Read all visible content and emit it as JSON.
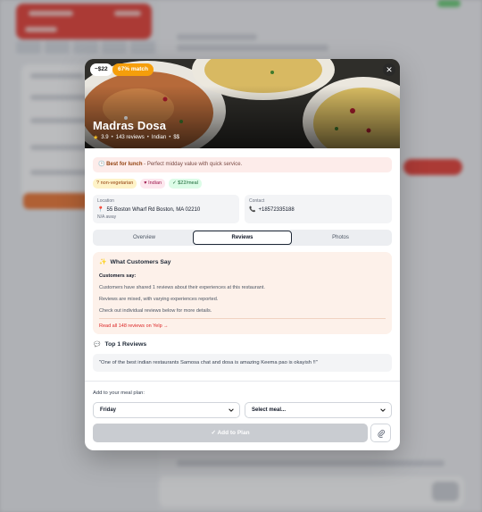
{
  "modal": {
    "price_badge": "~$22",
    "match_badge": "67% match",
    "close_glyph": "✕",
    "restaurant_name": "Madras Dosa",
    "rating": "3.9",
    "review_count": "143 reviews",
    "cuisine": "Indian",
    "price_level": "$$",
    "banner": {
      "title": "Best for lunch",
      "text": " - Perfect midday value with quick service."
    },
    "tags": [
      "non-vegetarian",
      "Indian",
      "$22/meal"
    ],
    "tag_icons": [
      "?",
      "♥",
      "✓"
    ],
    "location": {
      "label": "Location",
      "address": "55 Boston Wharf Rd Boston, MA 02210",
      "distance": "N/A away"
    },
    "contact": {
      "label": "Contact",
      "phone": "+18572335188"
    },
    "tabs": [
      "Overview",
      "Reviews",
      "Photos"
    ],
    "active_tab": "Reviews",
    "reviews_panel": {
      "heading": "What Customers Say",
      "subheading": "Customers say:",
      "lines": [
        "Customers have shared 1 reviews about their experiences at this restaurant.",
        "Reviews are mixed, with varying experiences reported.",
        "Check out individual reviews below for more details."
      ],
      "link": "Read all 148 reviews on Yelp →"
    },
    "top_reviews_heading": "Top 1 Reviews",
    "top_review_quote": "\"One of the best indian restaurants Samosa chat and dosa is amazing Keema pao is okayish !!\"",
    "meal_plan": {
      "label": "Add to your meal plan:",
      "day_value": "Friday",
      "meal_placeholder": "Select meal...",
      "add_button": "✓ Add to Plan"
    }
  },
  "colors": {
    "accent": "#e11d48",
    "match_badge": "#f59e0b",
    "review_panel_bg": "#fdf1ea",
    "disabled_button": "#c9ccd1"
  },
  "icons": {
    "close": "close-icon",
    "star": "star-icon",
    "pin": "map-pin-icon",
    "phone": "phone-icon",
    "sparkle": "sparkle-icon",
    "chat": "chat-bubble-icon",
    "chevron": "chevron-down-icon",
    "attach": "paperclip-icon"
  }
}
